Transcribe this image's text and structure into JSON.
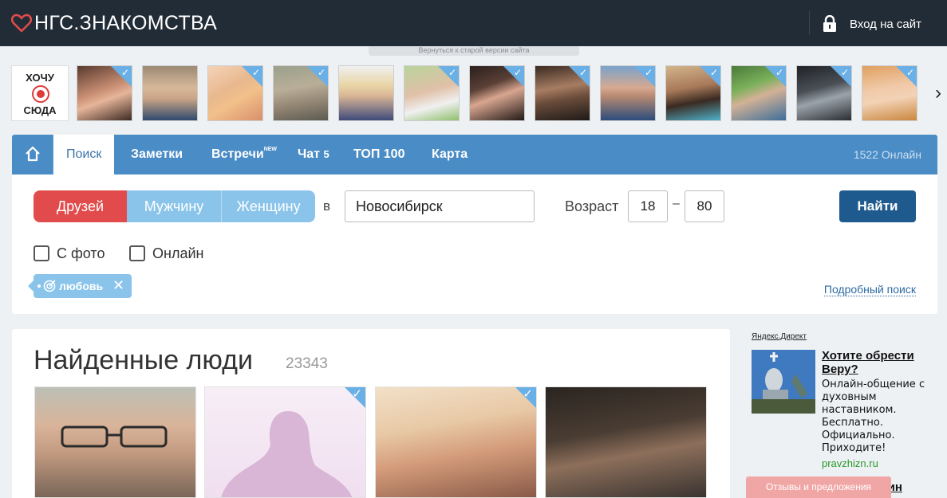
{
  "header": {
    "logo_text": "НГС.ЗНАКОМСТВА",
    "login_label": "Вход на сайт",
    "old_version_link": "Вернуться к старой версии сайта"
  },
  "strip": {
    "want_here_line1": "ХОЧУ",
    "want_here_line2": "СЮДА",
    "next_arrow": "›"
  },
  "nav": {
    "tabs": [
      {
        "label": "Поиск"
      },
      {
        "label": "Заметки"
      },
      {
        "label": "Встречи",
        "badge": "NEW"
      },
      {
        "label": "Чат",
        "count": "5"
      },
      {
        "label": "ТОП 100"
      },
      {
        "label": "Карта"
      }
    ],
    "online": "1522 Онлайн"
  },
  "search": {
    "segments": [
      "Друзей",
      "Мужчину",
      "Женщину"
    ],
    "in_label": "в",
    "city": "Новосибирск",
    "age_label": "Возраст",
    "age_from": "18",
    "age_to": "80",
    "age_dash": "–",
    "find_button": "Найти",
    "checkbox_photo": "С фото",
    "checkbox_online": "Онлайн",
    "tag": "любовь",
    "tag_close": "✕",
    "advanced": "Подробный поиск"
  },
  "results": {
    "title": "Найденные люди",
    "count": "23343"
  },
  "ads": {
    "label": "Яндекс.Директ",
    "title": "Хотите обрести Веру?",
    "text": "Онлайн-общение с духовным наставником. Бесплатно. Официально. Приходите!",
    "url": "pravzhizn.ru",
    "second_title": "щин"
  },
  "feedback": "Отзывы и предложения",
  "colors": {
    "header_bg": "#222c36",
    "nav_bg": "#4a8cc6",
    "accent_red": "#e24b4b",
    "accent_light_blue": "#8ac4ea",
    "button_dark_blue": "#1f5a8e",
    "check_badge": "#6ab0e6"
  }
}
